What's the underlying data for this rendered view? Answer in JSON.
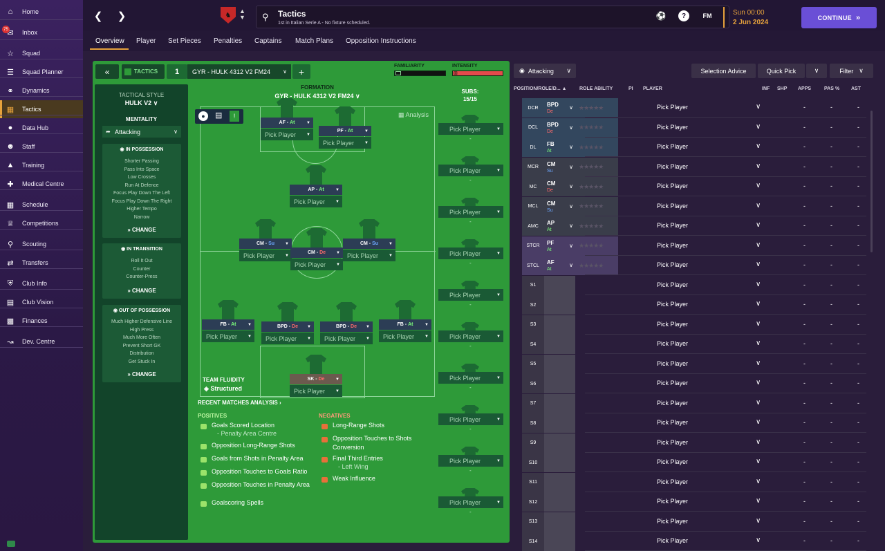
{
  "sidebar": {
    "items": [
      {
        "label": "Home",
        "icon": "home-icon"
      },
      {
        "label": "Inbox",
        "icon": "inbox-icon",
        "badge": "75"
      },
      {
        "label": "Squad",
        "icon": "shirt-icon"
      },
      {
        "label": "Squad Planner",
        "icon": "clipboard-icon"
      },
      {
        "label": "Dynamics",
        "icon": "handshake-icon"
      },
      {
        "label": "Tactics",
        "icon": "tactics-icon"
      },
      {
        "label": "Data Hub",
        "icon": "data-hub-icon"
      },
      {
        "label": "Staff",
        "icon": "staff-icon"
      },
      {
        "label": "Training",
        "icon": "training-cone-icon"
      },
      {
        "label": "Medical Centre",
        "icon": "medical-icon"
      },
      {
        "label": "Schedule",
        "icon": "calendar-icon"
      },
      {
        "label": "Competitions",
        "icon": "trophy-icon"
      },
      {
        "label": "Scouting",
        "icon": "search-icon"
      },
      {
        "label": "Transfers",
        "icon": "transfer-icon"
      },
      {
        "label": "Club Info",
        "icon": "shield-icon"
      },
      {
        "label": "Club Vision",
        "icon": "briefcase-icon"
      },
      {
        "label": "Finances",
        "icon": "money-icon"
      },
      {
        "label": "Dev. Centre",
        "icon": "dev-centre-icon"
      }
    ]
  },
  "header": {
    "title": "Tactics",
    "subtitle": "1st in Italian Serie A - No fixture scheduled.",
    "fm_label": "FM",
    "help_label": "?",
    "time": "Sun 00:00",
    "date": "2 Jun 2024",
    "continue_label": "CONTINUE"
  },
  "tabs": [
    "Overview",
    "Player",
    "Set Pieces",
    "Penalties",
    "Captains",
    "Match Plans",
    "Opposition Instructions"
  ],
  "panel": {
    "tactics_label": "TACTICS",
    "slot": "1",
    "tactic_name": "GYR - HULK 4312 V2 FM24",
    "familiarity_label": "FAMILIARITY",
    "intensity_label": "INTENSITY",
    "tactical_style_label": "TACTICAL STYLE",
    "tactical_style": "HULK V2",
    "mentality_label": "MENTALITY",
    "mentality": "Attacking",
    "in_possession": {
      "title": "IN POSSESSION",
      "items": [
        "Shorter Passing",
        "Pass Into Space",
        "Low Crosses",
        "Run At Defence",
        "Focus Play Down The Left",
        "Focus Play Down The Right",
        "Higher Tempo",
        "Narrow"
      ]
    },
    "in_transition": {
      "title": "IN TRANSITION",
      "items": [
        "Roll It Out",
        "Counter",
        "Counter-Press"
      ]
    },
    "out_of_possession": {
      "title": "OUT OF POSSESSION",
      "items": [
        "Much Higher Defensive Line",
        "High Press",
        "Much More Often",
        "Prevent Short GK",
        "Distribution",
        "Get Stuck In"
      ]
    },
    "change_label": "CHANGE",
    "formation_label": "FORMATION",
    "formation_name": "GYR - HULK 4312 V2 FM24",
    "subs_label": "SUBS:",
    "subs_count": "15/15",
    "analysis_label": "Analysis",
    "team_fluidity_label": "TEAM FLUIDITY",
    "team_fluidity": "Structured",
    "pick_player": "Pick Player",
    "sub_dash": "-",
    "recent_label": "RECENT MATCHES ANALYSIS",
    "positives_label": "POSITIVES",
    "negatives_label": "NEGATIVES",
    "positives": [
      {
        "text": "Goals Scored Location",
        "sub": "- Penalty Area Centre"
      },
      {
        "text": "Opposition Long-Range Shots"
      },
      {
        "text": "Goals from Shots in Penalty Area"
      },
      {
        "text": "Opposition Touches to Goals Ratio"
      },
      {
        "text": "Opposition Touches in Penalty Area"
      },
      {
        "text": "Goalscoring Spells"
      }
    ],
    "negatives": [
      {
        "text": "Long-Range Shots"
      },
      {
        "text": "Opposition Touches to Shots Conversion"
      },
      {
        "text": "Final Third Entries",
        "sub": "- Left Wing"
      },
      {
        "text": "Weak Influence"
      }
    ]
  },
  "players_on_pitch": [
    {
      "role": "AF",
      "duty": "At"
    },
    {
      "role": "PF",
      "duty": "At"
    },
    {
      "role": "AP",
      "duty": "At"
    },
    {
      "role": "CM",
      "duty": "Su"
    },
    {
      "role": "CM",
      "duty": "De"
    },
    {
      "role": "CM",
      "duty": "Su"
    },
    {
      "role": "FB",
      "duty": "At"
    },
    {
      "role": "BPD",
      "duty": "De"
    },
    {
      "role": "BPD",
      "duty": "De"
    },
    {
      "role": "FB",
      "duty": "At"
    },
    {
      "role": "SK",
      "duty": "De"
    }
  ],
  "right": {
    "mentality": "Attacking",
    "selection_advice": "Selection Advice",
    "quick_pick": "Quick Pick",
    "filter": "Filter",
    "headers": {
      "position": "POSITION/ROLE/D...",
      "role_ability": "ROLE ABILITY",
      "pi": "PI",
      "player": "PLAYER",
      "inf": "INF",
      "shp": "SHP",
      "apps": "APPS",
      "pas": "PAS %",
      "ast": "AST"
    },
    "dash": "-",
    "rows": [
      {
        "pos": "DCR",
        "role": "BPD",
        "duty": "De"
      },
      {
        "pos": "DCL",
        "role": "BPD",
        "duty": "De"
      },
      {
        "pos": "DL",
        "role": "FB",
        "duty": "At"
      },
      {
        "pos": "MCR",
        "role": "CM",
        "duty": "Su"
      },
      {
        "pos": "MC",
        "role": "CM",
        "duty": "De"
      },
      {
        "pos": "MCL",
        "role": "CM",
        "duty": "Su"
      },
      {
        "pos": "AMC",
        "role": "AP",
        "duty": "At"
      },
      {
        "pos": "STCR",
        "role": "PF",
        "duty": "At"
      },
      {
        "pos": "STCL",
        "role": "AF",
        "duty": "At"
      },
      {
        "pos": "S1"
      },
      {
        "pos": "S2"
      },
      {
        "pos": "S3"
      },
      {
        "pos": "S4"
      },
      {
        "pos": "S5"
      },
      {
        "pos": "S6"
      },
      {
        "pos": "S7"
      },
      {
        "pos": "S8"
      },
      {
        "pos": "S9"
      },
      {
        "pos": "S10"
      },
      {
        "pos": "S11"
      },
      {
        "pos": "S12"
      },
      {
        "pos": "S13"
      },
      {
        "pos": "S14"
      }
    ]
  },
  "colors": {
    "accent": "#e6a23c",
    "continue": "#6a4fd6",
    "pitch": "#2e9a39",
    "attack": "#7cfc7c",
    "support": "#6ea8ff",
    "defend": "#ff6b6b"
  }
}
